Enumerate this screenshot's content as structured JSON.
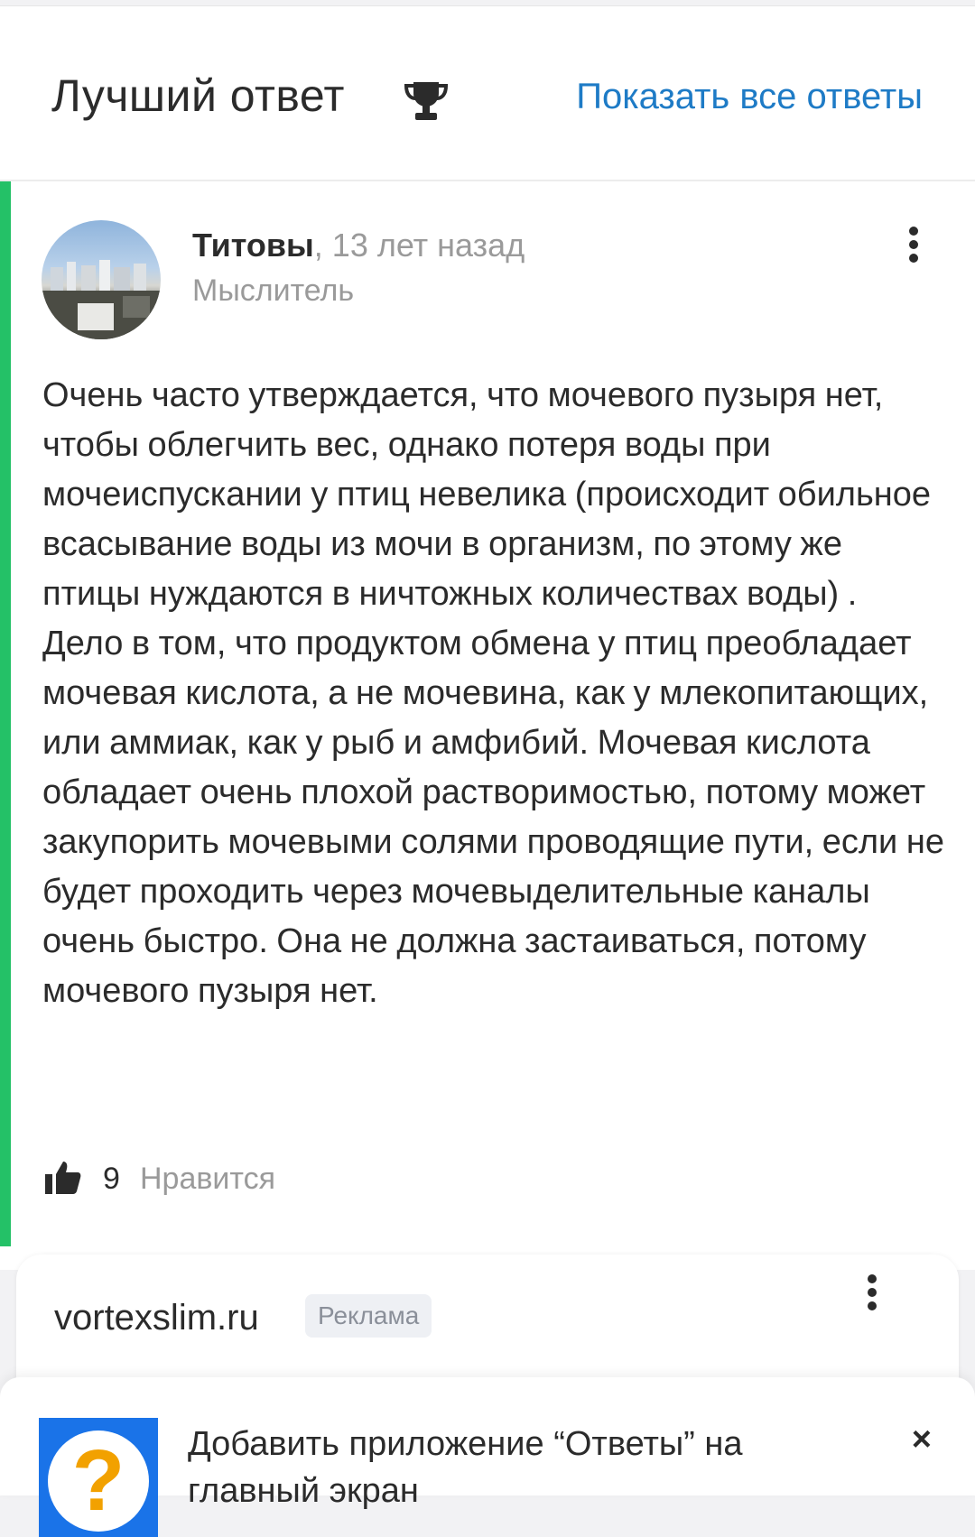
{
  "header": {
    "title": "Лучший ответ",
    "trophy_icon": "trophy-icon",
    "show_all": "Показать все ответы"
  },
  "answer": {
    "author": "Титовы",
    "time": "13 лет назад",
    "rank": "Мыслитель",
    "text": "Очень часто утверждается, что мочевого пузыря нет, чтобы облегчить вес, однако потеря воды при мочеиспускании у птиц невелика (происходит обильное всасывание воды из мочи в организм, по этому же птицы нуждаются в ничтожных количествах воды) . Дело в том, что продуктом обмена у птиц преобладает мочевая кислота, а не мочевина, как у млекопитающих, или аммиак, как у рыб и амфибий. Мочевая кислота обладает очень плохой растворимостью, потому может закупорить мочевыми солями проводящие пути, если не будет проходить через мочевыделительные каналы очень быстро. Она не должна застаиваться, потому мочевого пузыря нет.",
    "likes": "9",
    "like_label": "Нравится",
    "accent_color": "#24c167"
  },
  "ad": {
    "domain": "vortexslim.ru",
    "badge": "Реклама"
  },
  "install_prompt": {
    "text": "Добавить приложение “Ответы” на главный экран",
    "icon_glyph": "?",
    "close": "×"
  }
}
